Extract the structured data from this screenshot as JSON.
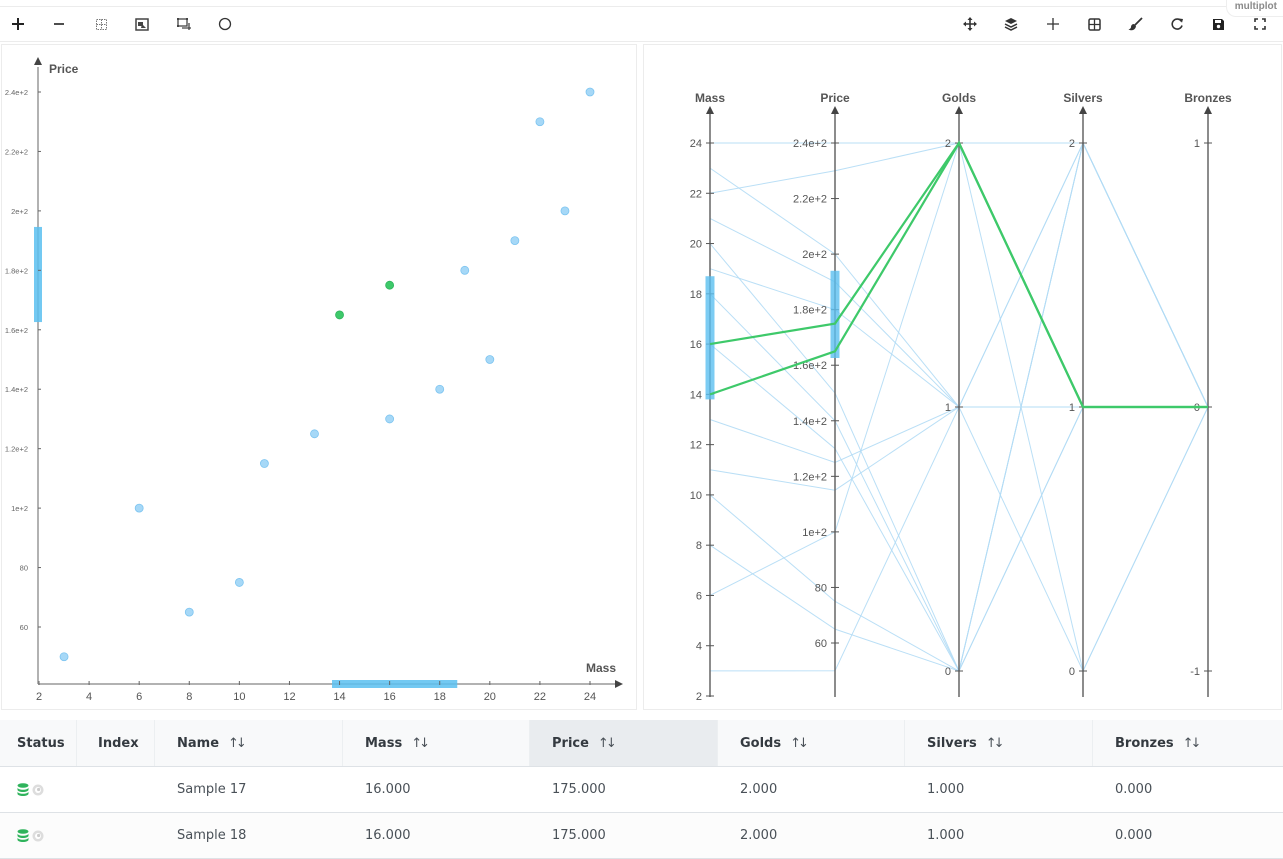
{
  "brand": "multiplot",
  "toolbar": {
    "left": [
      {
        "name": "zoom-in",
        "icon": "plus-icon"
      },
      {
        "name": "zoom-out",
        "icon": "minus-icon"
      },
      {
        "name": "box-select",
        "icon": "dotted-box-icon"
      },
      {
        "name": "image",
        "icon": "image-icon"
      },
      {
        "name": "lasso-select",
        "icon": "bounding-box-icon"
      },
      {
        "name": "circle-select",
        "icon": "circle-icon"
      }
    ],
    "right": [
      {
        "name": "pan",
        "icon": "move-icon"
      },
      {
        "name": "layers",
        "icon": "layers-icon"
      },
      {
        "name": "add",
        "icon": "plus-icon"
      },
      {
        "name": "grid",
        "icon": "grid-icon"
      },
      {
        "name": "brush",
        "icon": "brush-icon"
      },
      {
        "name": "reset",
        "icon": "refresh-icon"
      },
      {
        "name": "save",
        "icon": "save-icon"
      },
      {
        "name": "fullscreen",
        "icon": "fullscreen-icon"
      }
    ]
  },
  "colors": {
    "point": "#a6d8f7",
    "point_stroke": "#7cc4f0",
    "selected": "#3ec96a",
    "brush": "#5bbff0",
    "line": "#b3dcf5",
    "axis": "#666666"
  },
  "chart_data": [
    {
      "type": "scatter",
      "xlabel": "Mass",
      "ylabel": "Price",
      "xlim": [
        2,
        25
      ],
      "ylim": [
        40,
        250
      ],
      "xticks": [
        2,
        4,
        6,
        8,
        10,
        12,
        14,
        16,
        18,
        20,
        22,
        24
      ],
      "yticks": [
        {
          "v": 60,
          "label": "60"
        },
        {
          "v": 80,
          "label": "80"
        },
        {
          "v": 100,
          "label": "1e+2"
        },
        {
          "v": 120,
          "label": "1.2e+2"
        },
        {
          "v": 140,
          "label": "1.4e+2"
        },
        {
          "v": 160,
          "label": "1.6e+2"
        },
        {
          "v": 180,
          "label": "1.8e+2"
        },
        {
          "v": 200,
          "label": "2e+2"
        },
        {
          "v": 220,
          "label": "2.2e+2"
        },
        {
          "v": 240,
          "label": "2.4e+2"
        }
      ],
      "brush_x": [
        13.7,
        18.7
      ],
      "brush_y": [
        162.6,
        194.6
      ],
      "points": [
        {
          "x": 3,
          "y": 50,
          "selected": false
        },
        {
          "x": 6,
          "y": 100,
          "selected": false
        },
        {
          "x": 8,
          "y": 65,
          "selected": false
        },
        {
          "x": 10,
          "y": 75,
          "selected": false
        },
        {
          "x": 11,
          "y": 115,
          "selected": false
        },
        {
          "x": 13,
          "y": 125,
          "selected": false
        },
        {
          "x": 14,
          "y": 165,
          "selected": true
        },
        {
          "x": 16,
          "y": 175,
          "selected": true
        },
        {
          "x": 16,
          "y": 130,
          "selected": false
        },
        {
          "x": 18,
          "y": 140,
          "selected": false
        },
        {
          "x": 19,
          "y": 180,
          "selected": false
        },
        {
          "x": 20,
          "y": 150,
          "selected": false
        },
        {
          "x": 21,
          "y": 190,
          "selected": false
        },
        {
          "x": 22,
          "y": 230,
          "selected": false
        },
        {
          "x": 23,
          "y": 200,
          "selected": false
        },
        {
          "x": 24,
          "y": 240,
          "selected": false
        }
      ]
    },
    {
      "type": "parallel-coordinates",
      "axes": [
        {
          "name": "Mass",
          "range": [
            2,
            25.5
          ],
          "ticks": [
            {
              "v": 2,
              "label": "2"
            },
            {
              "v": 4,
              "label": "4"
            },
            {
              "v": 6,
              "label": "6"
            },
            {
              "v": 8,
              "label": "8"
            },
            {
              "v": 10,
              "label": "10"
            },
            {
              "v": 12,
              "label": "12"
            },
            {
              "v": 14,
              "label": "14"
            },
            {
              "v": 16,
              "label": "16"
            },
            {
              "v": 18,
              "label": "18"
            },
            {
              "v": 20,
              "label": "20"
            },
            {
              "v": 22,
              "label": "22"
            },
            {
              "v": 24,
              "label": "24"
            }
          ],
          "brush": [
            13.8,
            18.7
          ]
        },
        {
          "name": "Price",
          "range": [
            40,
            252
          ],
          "ticks": [
            {
              "v": 60,
              "label": "60"
            },
            {
              "v": 80,
              "label": "80"
            },
            {
              "v": 100,
              "label": "1e+2"
            },
            {
              "v": 120,
              "label": "1.2e+2"
            },
            {
              "v": 140,
              "label": "1.4e+2"
            },
            {
              "v": 160,
              "label": "1.6e+2"
            },
            {
              "v": 180,
              "label": "1.8e+2"
            },
            {
              "v": 200,
              "label": "2e+2"
            },
            {
              "v": 220,
              "label": "2.2e+2"
            },
            {
              "v": 240,
              "label": "2.4e+2"
            }
          ],
          "brush": [
            162.6,
            194
          ]
        },
        {
          "name": "Golds",
          "range": [
            -0.1,
            2.18
          ],
          "ticks": [
            {
              "v": 0,
              "label": "0"
            },
            {
              "v": 1,
              "label": "1"
            },
            {
              "v": 2,
              "label": "2"
            }
          ]
        },
        {
          "name": "Silvers",
          "range": [
            -0.1,
            2.18
          ],
          "ticks": [
            {
              "v": 0,
              "label": "0"
            },
            {
              "v": 1,
              "label": "1"
            },
            {
              "v": 2,
              "label": "2"
            }
          ]
        },
        {
          "name": "Bronzes",
          "range": [
            -1.1,
            1.18
          ],
          "ticks": [
            {
              "v": -1,
              "label": "-1"
            },
            {
              "v": 0,
              "label": "0"
            },
            {
              "v": 1,
              "label": "1"
            }
          ]
        }
      ],
      "lines": [
        {
          "values": [
            24,
            240,
            2,
            2,
            0
          ],
          "selected": false
        },
        {
          "values": [
            22,
            230,
            2,
            0,
            0
          ],
          "selected": false
        },
        {
          "values": [
            23,
            200,
            1,
            2,
            0
          ],
          "selected": false
        },
        {
          "values": [
            21,
            190,
            1,
            1,
            0
          ],
          "selected": false
        },
        {
          "values": [
            19,
            180,
            1,
            0,
            0
          ],
          "selected": false
        },
        {
          "values": [
            20,
            150,
            0,
            2,
            0
          ],
          "selected": false
        },
        {
          "values": [
            18,
            140,
            0,
            1,
            0
          ],
          "selected": false
        },
        {
          "values": [
            16,
            130,
            0,
            2,
            0
          ],
          "selected": false
        },
        {
          "values": [
            13,
            125,
            1,
            1,
            0
          ],
          "selected": false
        },
        {
          "values": [
            11,
            115,
            1,
            2,
            0
          ],
          "selected": false
        },
        {
          "values": [
            6,
            100,
            2,
            1,
            0
          ],
          "selected": false
        },
        {
          "values": [
            10,
            75,
            0,
            1,
            0
          ],
          "selected": false
        },
        {
          "values": [
            8,
            65,
            0,
            2,
            0
          ],
          "selected": false
        },
        {
          "values": [
            3,
            50,
            1,
            1,
            0
          ],
          "selected": false
        },
        {
          "values": [
            16,
            175,
            2,
            1,
            0
          ],
          "selected": true
        },
        {
          "values": [
            14,
            165,
            2,
            1,
            0
          ],
          "selected": true
        }
      ]
    }
  ],
  "table": {
    "columns": [
      {
        "label": "Status",
        "sortable": false
      },
      {
        "label": "Index",
        "sortable": false
      },
      {
        "label": "Name",
        "sortable": true
      },
      {
        "label": "Mass",
        "sortable": true
      },
      {
        "label": "Price",
        "sortable": true,
        "sorted": true
      },
      {
        "label": "Golds",
        "sortable": true
      },
      {
        "label": "Silvers",
        "sortable": true
      },
      {
        "label": "Bronzes",
        "sortable": true
      }
    ],
    "sort_icon": "⇅",
    "rows": [
      {
        "status": [
          "database-icon",
          "eye-icon"
        ],
        "index": "",
        "name": "Sample 17",
        "mass": "16.000",
        "price": "175.000",
        "golds": "2.000",
        "silvers": "1.000",
        "bronzes": "0.000"
      },
      {
        "status": [
          "database-icon",
          "eye-icon"
        ],
        "index": "",
        "name": "Sample 18",
        "mass": "16.000",
        "price": "175.000",
        "golds": "2.000",
        "silvers": "1.000",
        "bronzes": "0.000"
      }
    ]
  }
}
